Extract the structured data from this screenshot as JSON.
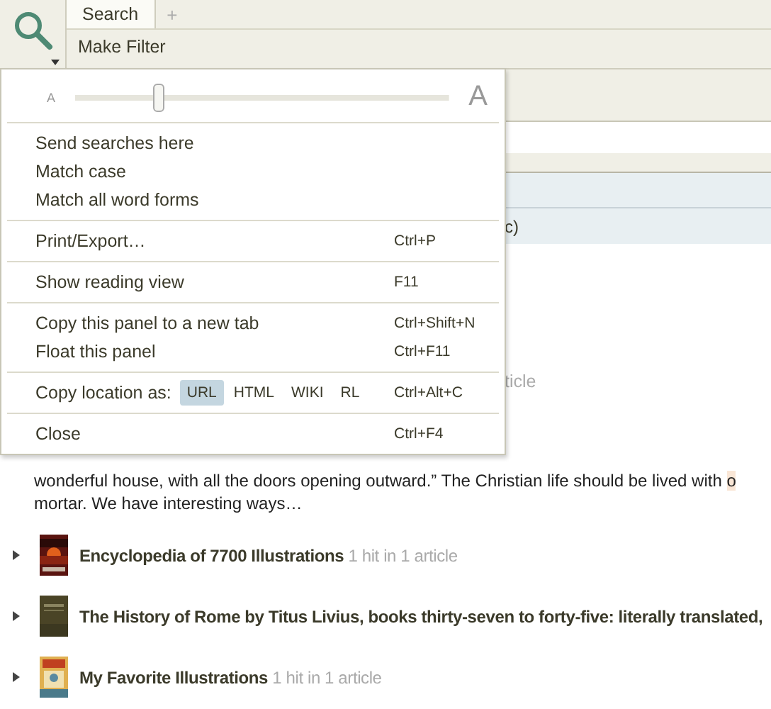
{
  "toolbar": {
    "tabs": [
      {
        "label": "Search",
        "selected": true
      }
    ],
    "add_tab": "+",
    "filter_button": "Make Filter"
  },
  "behind_menu": [
    {
      "kind": "header",
      "text": "c)"
    },
    {
      "kind": "hits",
      "text": "ticle"
    }
  ],
  "menu": {
    "text_size": {
      "small": "A",
      "large": "A",
      "level": 0.22
    },
    "groups": [
      [
        {
          "kind": "plain",
          "label": "Send searches here"
        },
        {
          "kind": "plain",
          "label": "Match case"
        },
        {
          "kind": "plain",
          "label": "Match all word forms"
        }
      ],
      [
        {
          "kind": "plain",
          "label": "Print/Export…",
          "shortcut": "Ctrl+P"
        }
      ],
      [
        {
          "kind": "plain",
          "label": "Show reading view",
          "shortcut": "F11"
        }
      ],
      [
        {
          "kind": "plain",
          "label": "Copy this panel to a new tab",
          "shortcut": "Ctrl+Shift+N"
        },
        {
          "kind": "plain",
          "label": "Float this panel",
          "shortcut": "Ctrl+F11"
        }
      ],
      [
        {
          "kind": "formats",
          "label": "Copy location as:",
          "formats": [
            {
              "label": "URL",
              "selected": true
            },
            {
              "label": "HTML",
              "selected": false
            },
            {
              "label": "WIKI",
              "selected": false
            },
            {
              "label": "RL",
              "selected": false
            }
          ],
          "shortcut": "Ctrl+Alt+C"
        }
      ],
      [
        {
          "kind": "plain",
          "label": "Close",
          "shortcut": "Ctrl+F4"
        }
      ]
    ]
  },
  "excerpt": {
    "lines": [
      {
        "text": "wonderful house, with all the doors opening outward.” The Christian life should be lived with ",
        "highlight": "o"
      },
      {
        "text": "mortar. We have interesting ways…"
      }
    ]
  },
  "books": [
    {
      "title": "Encyclopedia of 7700 Illustrations",
      "hits": "1 hit in 1 article",
      "expanded": false
    },
    {
      "title": "The History of Rome by Titus Livius, books thirty-seven to forty-five: literally translated,",
      "expanded": false
    },
    {
      "title": "My Favorite Illustrations",
      "hits": "1 hit in 1 article",
      "expanded": false
    }
  ]
}
